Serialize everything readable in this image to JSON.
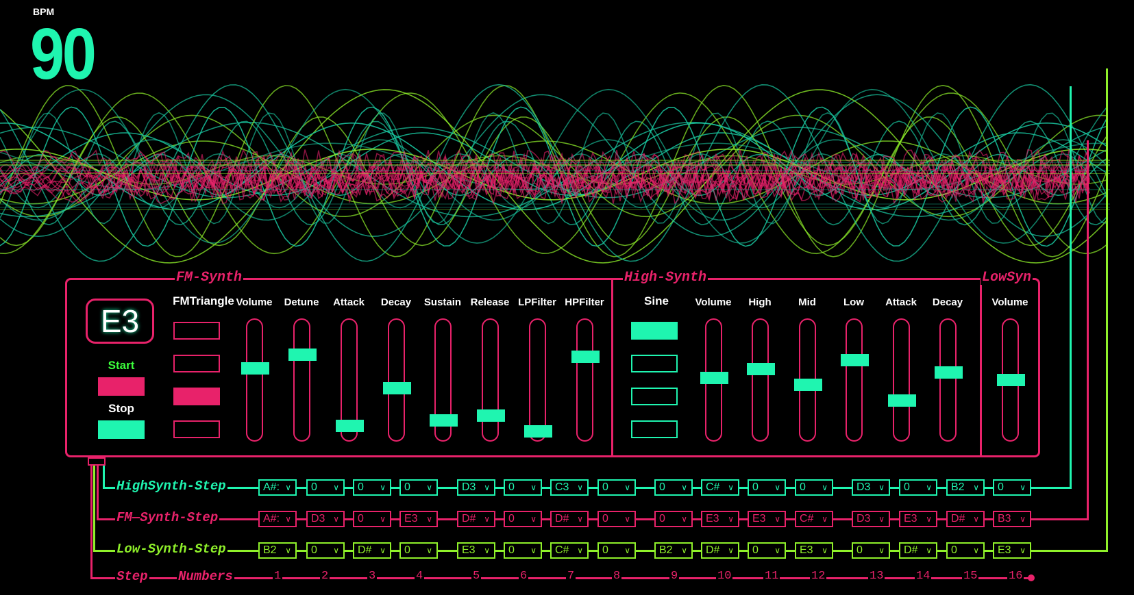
{
  "bpm": {
    "label": "BPM",
    "value": "90"
  },
  "colors": {
    "pink": "#e8226a",
    "teal": "#1ff5b0",
    "lime": "#8ff02a"
  },
  "sections": {
    "fm": "FM-Synth",
    "high": "High-Synth",
    "low": "LowSyn"
  },
  "note_display": "E3",
  "transport": {
    "start": "Start",
    "stop": "Stop"
  },
  "fm": {
    "waveform_label": "FMTriangle",
    "waveform_selected_index": 2,
    "sliders": [
      {
        "label": "Volume",
        "level": 0.62
      },
      {
        "label": "Detune",
        "level": 0.74
      },
      {
        "label": "Attack",
        "level": 0.1
      },
      {
        "label": "Decay",
        "level": 0.44
      },
      {
        "label": "Sustain",
        "level": 0.15
      },
      {
        "label": "Release",
        "level": 0.19
      },
      {
        "label": "LPFilter",
        "level": 0.05
      },
      {
        "label": "HPFilter",
        "level": 0.72
      }
    ]
  },
  "high": {
    "waveform_label": "Sine",
    "waveform_selected_index": 0,
    "sliders": [
      {
        "label": "Volume",
        "level": 0.53
      },
      {
        "label": "High",
        "level": 0.61
      },
      {
        "label": "Mid",
        "level": 0.47
      },
      {
        "label": "Low",
        "level": 0.69
      },
      {
        "label": "Attack",
        "level": 0.33
      },
      {
        "label": "Decay",
        "level": 0.58
      }
    ]
  },
  "low": {
    "sliders": [
      {
        "label": "Volume",
        "level": 0.51
      }
    ]
  },
  "steps": {
    "high": {
      "label": "HighSynth-Step",
      "values": [
        "A#:",
        "0",
        "0",
        "0",
        "D3",
        "0",
        "C3",
        "0",
        "0",
        "C#",
        "0",
        "0",
        "D3",
        "0",
        "B2",
        "0"
      ]
    },
    "fm": {
      "label": "FM—Synth-Step",
      "values": [
        "A#:",
        "D3",
        "0",
        "E3",
        "D#",
        "0",
        "D#",
        "0",
        "0",
        "E3",
        "E3",
        "C#",
        "D3",
        "E3",
        "D#",
        "B3"
      ]
    },
    "low": {
      "label": "Low-Synth-Step",
      "values": [
        "B2",
        "0",
        "D#",
        "0",
        "E3",
        "0",
        "C#",
        "0",
        "B2",
        "D#",
        "0",
        "E3",
        "0",
        "D#",
        "0",
        "E3"
      ]
    },
    "numbers": {
      "label1": "Step",
      "label2": "Numbers",
      "values": [
        "1",
        "2",
        "3",
        "4",
        "5",
        "6",
        "7",
        "8",
        "9",
        "10",
        "11",
        "12",
        "13",
        "14",
        "15",
        "16"
      ]
    }
  }
}
